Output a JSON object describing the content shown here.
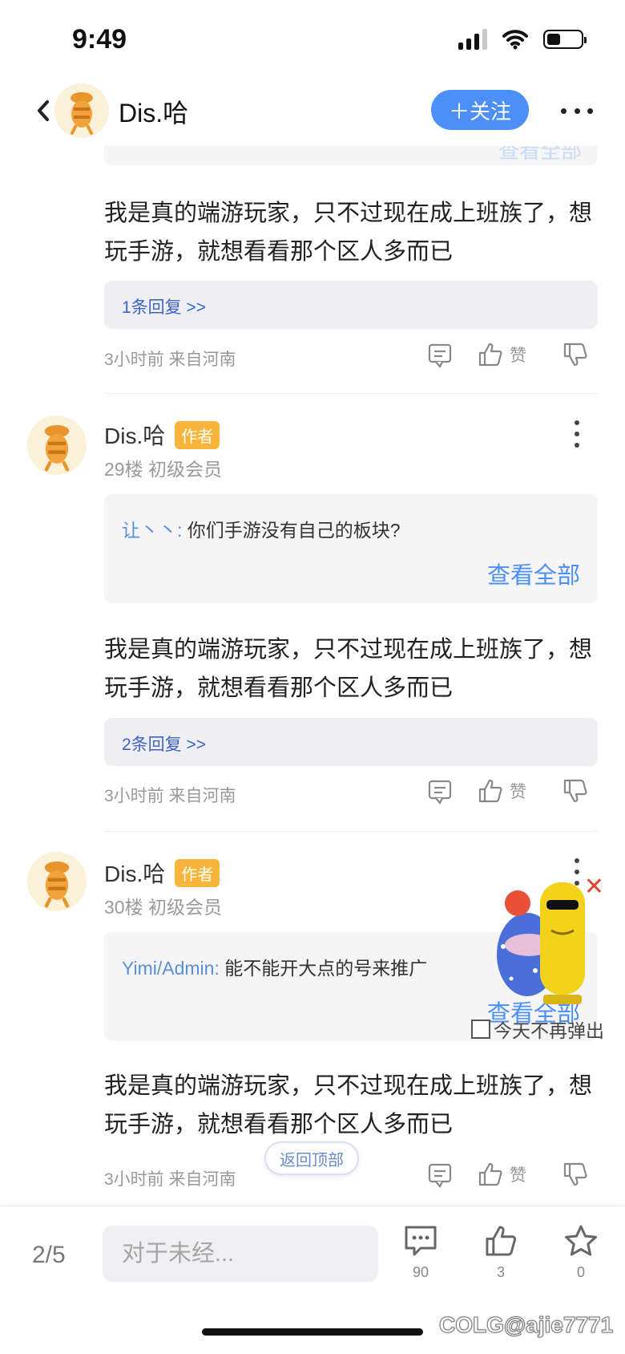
{
  "status_bar": {
    "time": "9:49"
  },
  "header": {
    "username": "Dis.哈",
    "follow_label": "＋关注"
  },
  "quote_remnant_text": "查看全部",
  "posts": [
    {
      "content": "我是真的端游玩家，只不过现在成上班族了，想玩手游，就想看看那个区人多而已",
      "replies": "1条回复 >>",
      "time_location": "3小时前 来自河南",
      "like_label": "赞"
    },
    {
      "author": "Dis.哈",
      "badge": "作者",
      "meta": "29楼 初级会员",
      "quote_user": "让丶丶:",
      "quote_text": "你们手游没有自己的板块?",
      "quote_more": "查看全部",
      "content": "我是真的端游玩家，只不过现在成上班族了，想玩手游，就想看看那个区人多而已",
      "replies": "2条回复 >>",
      "time_location": "3小时前 来自河南",
      "like_label": "赞"
    },
    {
      "author": "Dis.哈",
      "badge": "作者",
      "meta": "30楼 初级会员",
      "quote_user": "Yimi/Admin:",
      "quote_text": "能不能开大点的号来推广",
      "quote_more": "查看全部",
      "content": "我是真的端游玩家，只不过现在成上班族了，想玩手游，就想看看那个区人多而已",
      "time_location": "3小时前 来自河南",
      "like_label": "赞"
    }
  ],
  "popup": {
    "dismiss_label": "今天不再弹出",
    "close": "✕"
  },
  "back_to_top": "返回顶部",
  "bottom_bar": {
    "page": "2/5",
    "input_placeholder": "对于未经...",
    "comment_count": "90",
    "like_count": "3",
    "favorite_count": "0"
  },
  "watermark": "COLG@ajie7771",
  "colors": {
    "accent": "#4b8ff7",
    "badge": "#f9b53b",
    "reply_link": "#3d63c9"
  }
}
